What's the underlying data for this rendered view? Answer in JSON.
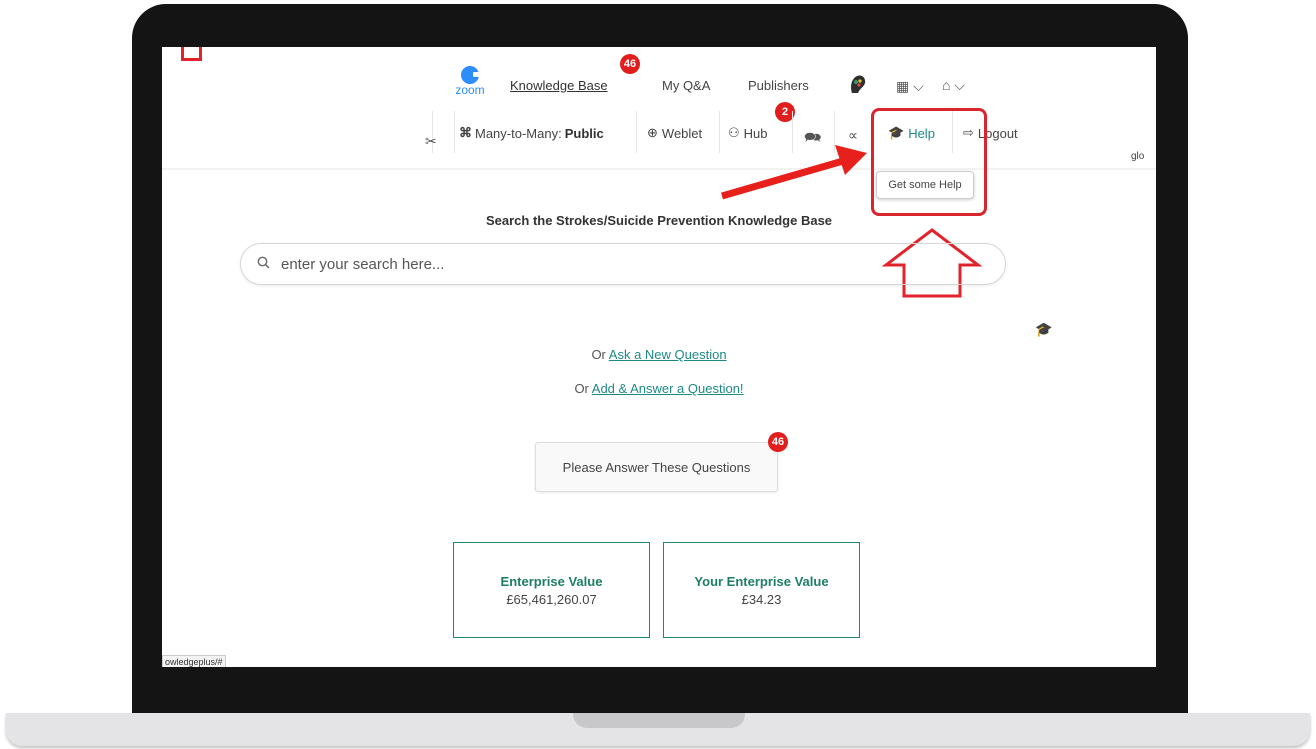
{
  "top_nav": {
    "logo_text": "zoom",
    "knowledge_base": "Knowledge Base",
    "kb_badge": "46",
    "my_qa": "My Q&A",
    "publishers": "Publishers"
  },
  "second_nav": {
    "many_prefix": "Many-to-Many: ",
    "many_value": "Public",
    "weblet": "Weblet",
    "hub": "Hub",
    "hub_badge": "2",
    "help": "Help",
    "logout": "Logout"
  },
  "help_tooltip": "Get some Help",
  "glo_text": "glo",
  "search": {
    "title": "Search the Strokes/Suicide Prevention Knowledge Base",
    "placeholder": "enter your search here..."
  },
  "links": {
    "or1": "Or ",
    "ask": "Ask a New Question",
    "or2": "Or ",
    "add": "Add & Answer a Question!"
  },
  "answer_button": {
    "label": "Please Answer These Questions",
    "badge": "46"
  },
  "cards": [
    {
      "title": "Enterprise Value",
      "value": "£65,461,260.07"
    },
    {
      "title": "Your Enterprise Value",
      "value": "£34.23"
    }
  ],
  "status_url": "owledgeplus/#",
  "colors": {
    "accent": "#1d8a84",
    "badge": "#e01e1e",
    "annotation": "#e3232b"
  }
}
